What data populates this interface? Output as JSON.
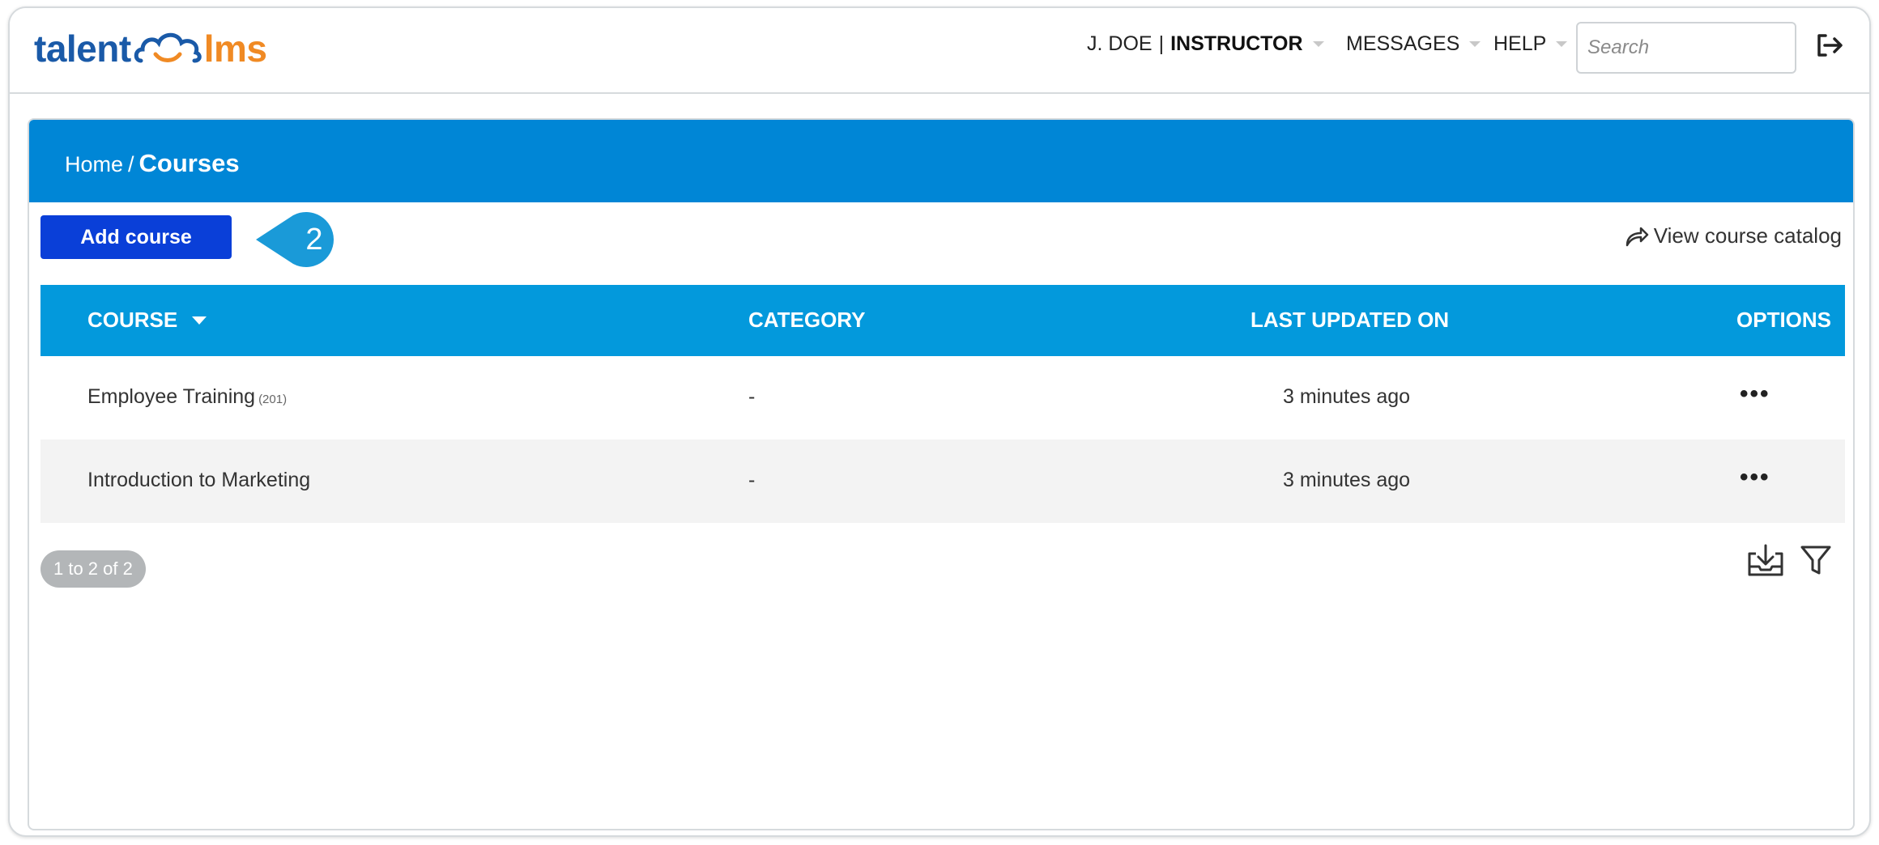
{
  "app": {
    "logo_left": "talent",
    "logo_right": "lms"
  },
  "header": {
    "user_name": "J. DOE",
    "user_role": "INSTRUCTOR",
    "messages_label": "MESSAGES",
    "help_label": "HELP",
    "search_placeholder": "Search",
    "logout_icon": "logout-icon"
  },
  "breadcrumb": {
    "home": "Home",
    "separator": "/",
    "current": "Courses"
  },
  "toolbar": {
    "add_course_label": "Add course",
    "step_number": "2",
    "view_catalog_label": "View course catalog"
  },
  "table": {
    "columns": [
      "COURSE",
      "CATEGORY",
      "LAST UPDATED ON",
      "OPTIONS"
    ],
    "rows": [
      {
        "course": "Employee Training",
        "code": "(201)",
        "category": "-",
        "updated": "3 minutes ago",
        "options": "•••"
      },
      {
        "course": "Introduction to Marketing",
        "code": "",
        "category": "-",
        "updated": "3 minutes ago",
        "options": "•••"
      }
    ]
  },
  "footer": {
    "pagination": "1 to 2 of 2",
    "export_icon": "export-icon",
    "filter_icon": "filter-icon"
  },
  "colors": {
    "banner": "#0086d6",
    "table_header": "#0399dc",
    "primary_button": "#0a3fd8",
    "logo_blue": "#1a5aa8",
    "logo_orange": "#f08a24",
    "callout": "#1a9ad8"
  }
}
